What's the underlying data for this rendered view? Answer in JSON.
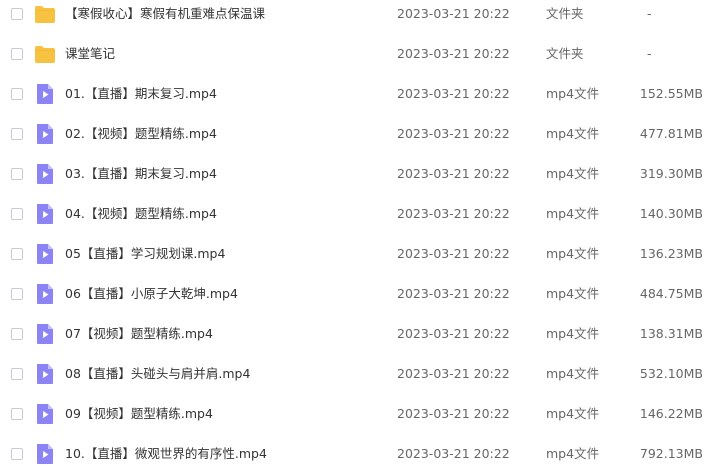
{
  "files": [
    {
      "name": "【寒假收心】寒假有机重难点保温课",
      "date": "2023-03-21 20:22",
      "type": "文件夹",
      "size": "-",
      "icon": "folder-icon"
    },
    {
      "name": "课堂笔记",
      "date": "2023-03-21 20:22",
      "type": "文件夹",
      "size": "-",
      "icon": "folder-icon"
    },
    {
      "name": "01.【直播】期末复习.mp4",
      "date": "2023-03-21 20:22",
      "type": "mp4文件",
      "size": "152.55MB",
      "icon": "video-file-icon"
    },
    {
      "name": "02.【视频】题型精练.mp4",
      "date": "2023-03-21 20:22",
      "type": "mp4文件",
      "size": "477.81MB",
      "icon": "video-file-icon"
    },
    {
      "name": "03.【直播】期末复习.mp4",
      "date": "2023-03-21 20:22",
      "type": "mp4文件",
      "size": "319.30MB",
      "icon": "video-file-icon"
    },
    {
      "name": "04.【视频】题型精练.mp4",
      "date": "2023-03-21 20:22",
      "type": "mp4文件",
      "size": "140.30MB",
      "icon": "video-file-icon"
    },
    {
      "name": "05【直播】学习规划课.mp4",
      "date": "2023-03-21 20:22",
      "type": "mp4文件",
      "size": "136.23MB",
      "icon": "video-file-icon"
    },
    {
      "name": "06【直播】小原子大乾坤.mp4",
      "date": "2023-03-21 20:22",
      "type": "mp4文件",
      "size": "484.75MB",
      "icon": "video-file-icon"
    },
    {
      "name": "07【视频】题型精练.mp4",
      "date": "2023-03-21 20:22",
      "type": "mp4文件",
      "size": "138.31MB",
      "icon": "video-file-icon"
    },
    {
      "name": "08【直播】头碰头与肩并肩.mp4",
      "date": "2023-03-21 20:22",
      "type": "mp4文件",
      "size": "532.10MB",
      "icon": "video-file-icon"
    },
    {
      "name": "09【视频】题型精练.mp4",
      "date": "2023-03-21 20:22",
      "type": "mp4文件",
      "size": "146.22MB",
      "icon": "video-file-icon"
    },
    {
      "name": "10.【直播】微观世界的有序性.mp4",
      "date": "2023-03-21 20:22",
      "type": "mp4文件",
      "size": "792.13MB",
      "icon": "video-file-icon"
    }
  ],
  "colors": {
    "folder": "#f7c242",
    "folder_tab": "#f2b52f",
    "video_icon": "#8c84f5",
    "video_fold": "#c7c1fb",
    "checkbox_border": "#c8ccd2",
    "text": "#333333",
    "muted_text": "#666666"
  }
}
